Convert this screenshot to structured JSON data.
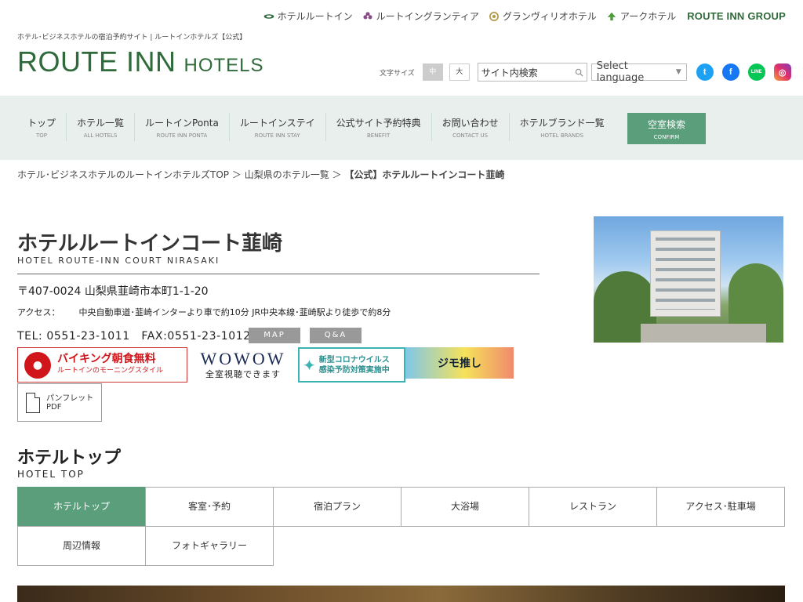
{
  "brands": [
    {
      "icon": "route-inn-leaf-icon",
      "label": "ホテルルートイン"
    },
    {
      "icon": "grantia-flower-icon",
      "label": "ルートイングランティア"
    },
    {
      "icon": "granvillio-emblem-icon",
      "label": "グランヴィリオホテル"
    },
    {
      "icon": "ark-hotel-icon",
      "label": "アークホテル"
    }
  ],
  "group_logo": "ROUTE INN GROUP",
  "tagline": "ホテル･ビジネスホテルの宿泊予約サイト | ルートインホテルズ【公式】",
  "logo": {
    "main": "ROUTE INN",
    "sub": "HOTELS"
  },
  "utility": {
    "font_size_label": "文字サイズ",
    "font_mid": "中",
    "font_large": "大",
    "search_placeholder": "サイト内検索",
    "language": "Select language"
  },
  "nav": [
    {
      "jp": "トップ",
      "en": "TOP"
    },
    {
      "jp": "ホテル一覧",
      "en": "ALL HOTELS"
    },
    {
      "jp": "ルートインPonta",
      "en": "ROUTE INN PONTA"
    },
    {
      "jp": "ルートインステイ",
      "en": "ROUTE INN STAY"
    },
    {
      "jp": "公式サイト予約特典",
      "en": "BENEFIT"
    },
    {
      "jp": "お問い合わせ",
      "en": "CONTACT US"
    },
    {
      "jp": "ホテルブランド一覧",
      "en": "HOTEL BRANDS"
    }
  ],
  "confirm": {
    "jp": "空室検索",
    "en": "CONFIRM"
  },
  "breadcrumb": {
    "item1": "ホテル･ビジネスホテルのルートインホテルズTOP",
    "sep": "＞",
    "item2": "山梨県のホテル一覧",
    "current": "【公式】ホテルルートインコート韮崎"
  },
  "hotel": {
    "name": "ホテルルートインコート韮崎",
    "name_en": "HOTEL ROUTE-INN COURT NIRASAKI",
    "address": "〒407-0024 山梨県韮崎市本町1-1-20",
    "access_label": "アクセス：",
    "access": "中央自動車道･韮崎インターより車で約10分 JR中央本線･韮崎駅より徒歩で約8分",
    "tel": "TEL: 0551-23-1011　FAX:0551-23-1012",
    "map_button": "MAP",
    "qa_button": "Q&A"
  },
  "banners": {
    "viking_title": "バイキング朝食無料",
    "viking_sub": "ルートインのモーニングスタイル",
    "wowow_logo": "WOWOW",
    "wowow_sub": "全室視聴できます",
    "corona_line1": "新型コロナウイルス",
    "corona_line2": "感染予防対策実施中",
    "jimo": "ジモ推し"
  },
  "pamphlet": {
    "line1": "パンフレット",
    "line2": "PDF"
  },
  "section": {
    "title": "ホテルトップ",
    "en": "HOTEL TOP"
  },
  "tabs": [
    "ホテルトップ",
    "客室･予約",
    "宿泊プラン",
    "大浴場",
    "レストラン",
    "アクセス･駐車場",
    "周辺情報",
    "フォトギャラリー"
  ],
  "colors": {
    "brand_green": "#2f6b3a",
    "accent": "#5a9e7c",
    "nav_bg": "#e9efec"
  }
}
